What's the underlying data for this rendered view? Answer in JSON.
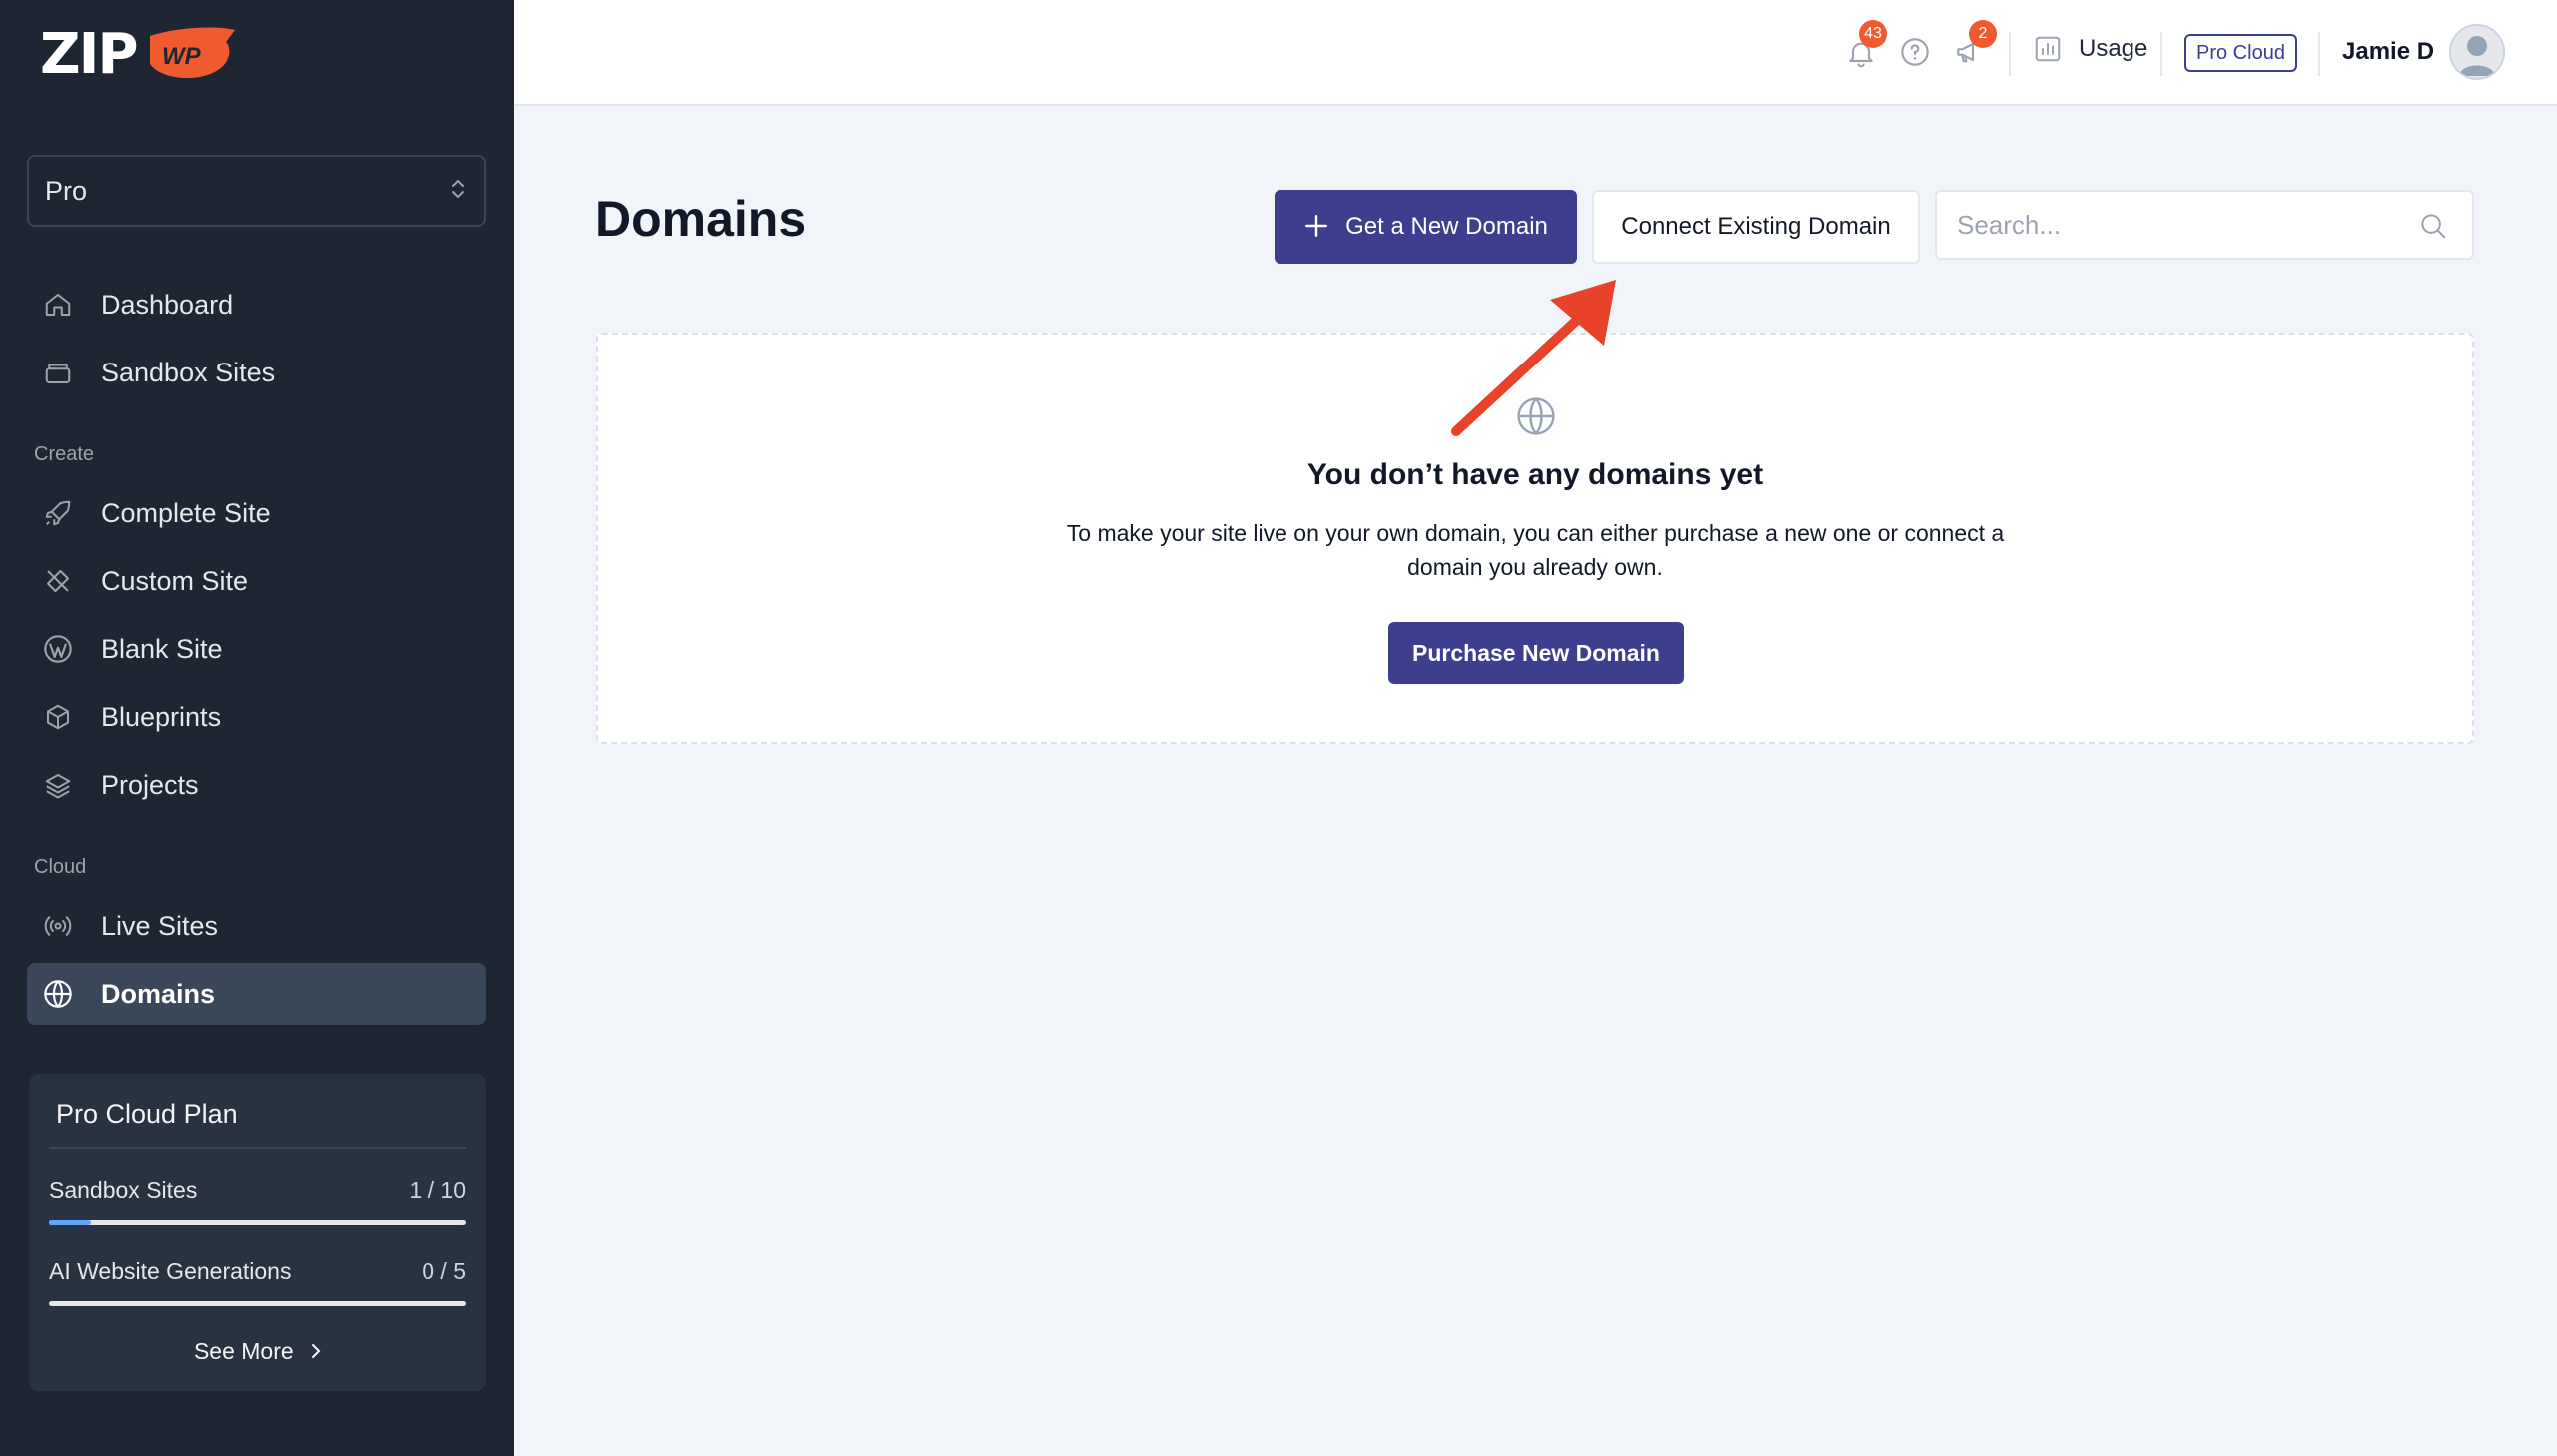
{
  "app": {
    "logo_text": "ZIP",
    "logo_badge": "WP"
  },
  "sidebar": {
    "plan_select": "Pro",
    "items_top": [
      {
        "label": "Dashboard",
        "icon": "home-icon"
      },
      {
        "label": "Sandbox Sites",
        "icon": "sandbox-icon"
      }
    ],
    "create_label": "Create",
    "create_items": [
      {
        "label": "Complete Site",
        "icon": "rocket-icon"
      },
      {
        "label": "Custom Site",
        "icon": "tools-icon"
      },
      {
        "label": "Blank Site",
        "icon": "wordpress-icon"
      },
      {
        "label": "Blueprints",
        "icon": "cube-icon"
      },
      {
        "label": "Projects",
        "icon": "layers-icon"
      }
    ],
    "cloud_label": "Cloud",
    "cloud_items": [
      {
        "label": "Live Sites",
        "icon": "broadcast-icon"
      },
      {
        "label": "Domains",
        "icon": "globe-icon",
        "active": true
      }
    ],
    "plan_card": {
      "title": "Pro Cloud Plan",
      "rows": [
        {
          "label": "Sandbox Sites",
          "value": "1 / 10",
          "progress": 0.1
        },
        {
          "label": "AI Website Generations",
          "value": "0 / 5",
          "progress": 0.0
        }
      ],
      "see_more": "See More"
    }
  },
  "topbar": {
    "notifications_count": "43",
    "announcements_count": "2",
    "usage_label": "Usage",
    "plan_badge": "Pro Cloud",
    "user_name": "Jamie D"
  },
  "main": {
    "title": "Domains",
    "get_domain_button": "Get a New Domain",
    "connect_domain_button": "Connect Existing Domain",
    "search_placeholder": "Search...",
    "empty_state": {
      "title": "You don’t have any domains yet",
      "description": "To make your site live on your own domain, you can either purchase a new one or connect a domain you already own.",
      "button": "Purchase New Domain"
    }
  },
  "colors": {
    "sidebar_bg": "#1e2633",
    "primary": "#3d3f8e",
    "accent_orange": "#ef5a2f",
    "annotation_arrow": "#e8432a"
  }
}
